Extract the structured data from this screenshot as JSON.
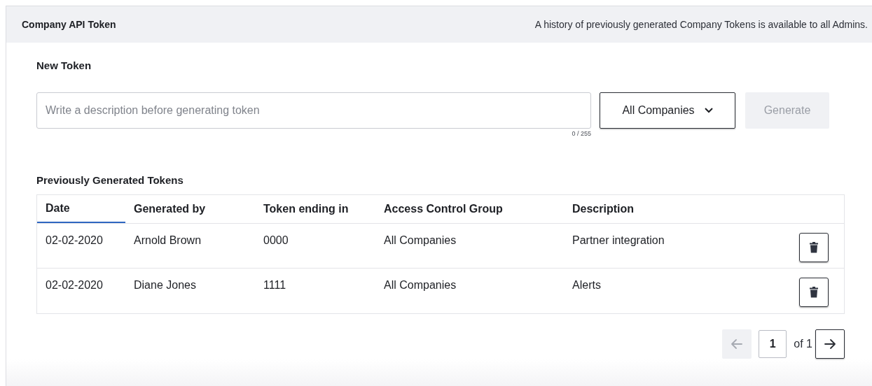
{
  "header": {
    "title": "Company API Token",
    "note": "A history of previously generated Company Tokens is available to all Admins."
  },
  "new_token": {
    "heading": "New Token",
    "description_field": {
      "placeholder": "Write a description before generating token",
      "counter": "0 / 255"
    },
    "company_select": {
      "value": "All Companies"
    },
    "generate_button": {
      "label": "Generate",
      "disabled": true
    }
  },
  "history": {
    "heading": "Previously Generated Tokens",
    "columns": [
      {
        "label": "Date",
        "sorted": true
      },
      {
        "label": "Generated by",
        "sorted": false
      },
      {
        "label": "Token ending in",
        "sorted": false
      },
      {
        "label": "Access Control Group",
        "sorted": false
      },
      {
        "label": "Description",
        "sorted": false
      }
    ],
    "rows": [
      {
        "cells": [
          "02-02-2020",
          "Arnold Brown",
          "0000",
          "All Companies",
          "Partner integration"
        ]
      },
      {
        "cells": [
          "02-02-2020",
          "Diane Jones",
          "1111",
          "All Companies",
          "Alerts"
        ]
      }
    ]
  },
  "pagination": {
    "previous_disabled": true,
    "page": "1",
    "total": "of 1",
    "next_disabled": false
  }
}
